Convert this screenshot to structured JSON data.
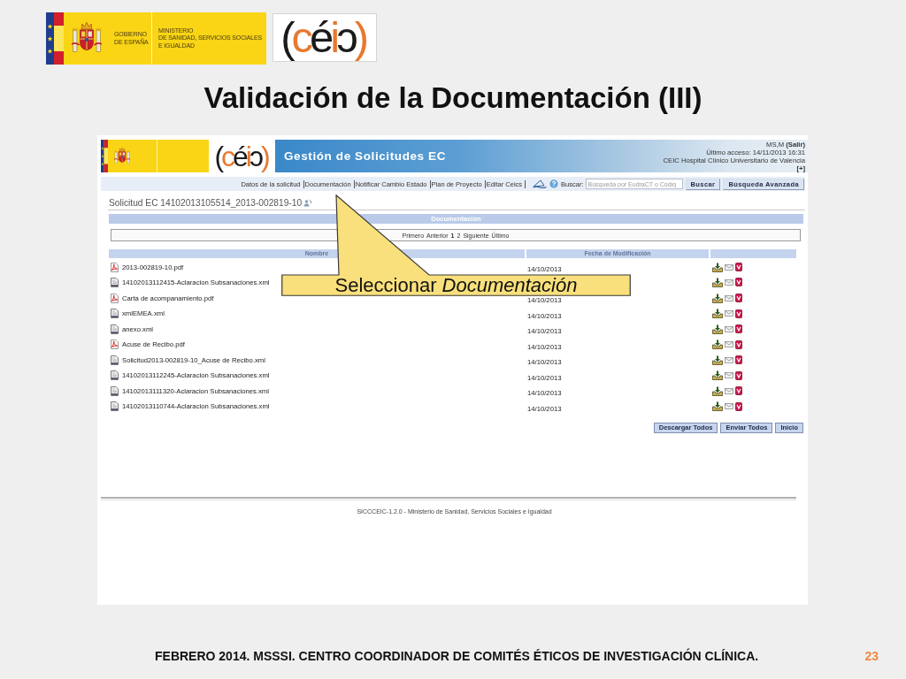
{
  "slide_header": {
    "gov_logo": {
      "government": [
        "GOBIERNO",
        "DE ESPAÑA"
      ],
      "ministry": [
        "MINISTERIO",
        "DE SANIDAD, SERVICIOS SOCIALES",
        "E IGUALDAD"
      ]
    },
    "ceic_logo": [
      {
        "text": "(",
        "color": "#1a1a1a"
      },
      {
        "text": "c",
        "color": "#e8782f"
      },
      {
        "text": "é",
        "color": "#1a1a1a"
      },
      {
        "text": "i",
        "color": "#e8782f"
      },
      {
        "text": "ɔ",
        "color": "#1a1a1a"
      },
      {
        "text": ")",
        "color": "#e8782f"
      }
    ]
  },
  "title": "Validación de la Documentación (III)",
  "app": {
    "header": {
      "ceic_logo": [
        {
          "text": "(",
          "color": "#1a1a1a"
        },
        {
          "text": "c",
          "color": "#e8782f"
        },
        {
          "text": "é",
          "color": "#1a1a1a"
        },
        {
          "text": "i",
          "color": "#e8782f"
        },
        {
          "text": "ɔ",
          "color": "#1a1a1a"
        },
        {
          "text": ")",
          "color": "#e8782f"
        }
      ],
      "app_title": "Gestión de Solicitudes EC",
      "user": "MS,M **(Salir)**",
      "last_access": "Último acceso: 14/11/2013 16:31",
      "center": "CEIC Hospital Clínico Universitario de Valencia",
      "expand": "[+]"
    },
    "nav": {
      "links": [
        "Datos de la solicitud",
        "Documentación",
        "Notificar Cambio Estado",
        "Plan de Proyecto",
        "Editar Ceics"
      ],
      "search_label": "Buscar:",
      "search": {
        "placeholder": "Búsqueda por EudraCT o Códig"
      },
      "buttons": [
        "Buscar",
        "Búsqueda Avanzada"
      ]
    },
    "request_title": "Solicitud EC 14102013105514_2013-002819-10",
    "section_title": "Documentación",
    "pager": {
      "first": "Primero",
      "previous": "Anterior",
      "pages": [
        {
          "label": "1",
          "selected": true
        },
        {
          "label": "2",
          "selected": false
        }
      ],
      "next": "Siguiente",
      "last": "Último"
    },
    "table": {
      "columns": [
        "Nombre",
        "Fecha de Modificación"
      ],
      "rows": [
        {
          "kind": "pdf",
          "name": "2013-002819-10.pdf",
          "date": "14/10/2013"
        },
        {
          "kind": "xml",
          "name": "14102013112415-Aclaracion Subsanaciones.xml"
        },
        {
          "kind": "pdf",
          "name": "Carta de acompanamiento.pdf",
          "date": "14/10/2013"
        },
        {
          "kind": "xml",
          "name": "xmlEMEA.xml",
          "date": "14/10/2013"
        },
        {
          "kind": "xml",
          "name": "anexo.xml",
          "date": "14/10/2013"
        },
        {
          "kind": "pdf",
          "name": "Acuse de Recibo.pdf",
          "date": "14/10/2013"
        },
        {
          "kind": "xml",
          "name": "Solicitud2013-002819-10_Acuse de Recibo.xml",
          "date": "14/10/2013"
        },
        {
          "kind": "xml",
          "name": "14102013112245-Aclaracion Subsanaciones.xml",
          "date": "14/10/2013"
        },
        {
          "kind": "xml",
          "name": "14102013111320-Aclaracion Subsanaciones.xml",
          "date": "14/10/2013"
        },
        {
          "kind": "xml",
          "name": "14102013110744-Aclaracion Subsanaciones.xml",
          "date": "14/10/2013"
        }
      ]
    },
    "buttons": [
      "Descargar Todos",
      "Enviar Todos",
      "Inicio"
    ],
    "footer": "SICCCEIC-1.2.0 - Ministerio de Sanidad, Servicios Sociales e Igualdad"
  },
  "callout": "Seleccionar *Documentación*",
  "slide_footer": {
    "text": "FEBRERO 2014. MSSSI. CENTRO COORDINADOR DE COMITÉS ÉTICOS DE INVESTIGACIÓN CLÍNICA.",
    "page": "23"
  }
}
